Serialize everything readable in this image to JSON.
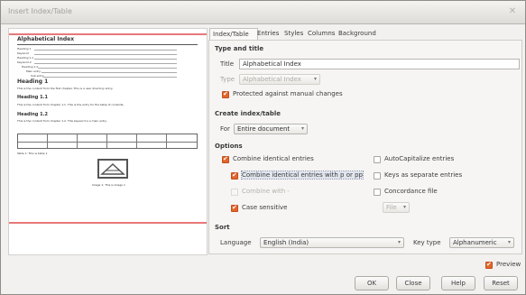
{
  "window": {
    "title": "Insert Index/Table"
  },
  "preview": {
    "heading": "Alphabetical Index",
    "index_entries": [
      "Heading 1",
      "Keyword",
      "Heading 1.1",
      "Keyword 2",
      "Heading 1.2",
      "Main entry",
      "Sub entry"
    ],
    "heading1": "Heading 1",
    "heading1_text": "This is the content from the first chapter. This is a user directory entry.",
    "heading11": "Heading 1.1",
    "heading11_text": "This is the content from chapter 1.1. This is the entry for the table of contents.",
    "heading12": "Heading 1.2",
    "heading12_text": "This is the content from chapter 1.2. This keyword is a main entry.",
    "table_caption": "Table 1: This is table 1",
    "image_caption": "Image 1: This is image 1",
    "show": true
  },
  "tabs": [
    "Index/Table",
    "Entries",
    "Styles",
    "Columns",
    "Background"
  ],
  "type_title": {
    "section": "Type and title",
    "title_label": "Title",
    "title_value": "Alphabetical Index",
    "type_label": "Type",
    "type_value": "Alphabetical Index",
    "protected_label": "Protected against manual changes",
    "protected_checked": true
  },
  "create": {
    "section": "Create index/table",
    "for_label": "For",
    "for_value": "Entire document"
  },
  "options": {
    "section": "Options",
    "combine_identical": "Combine identical entries",
    "combine_pp": "Combine identical entries with p or pp",
    "combine_with": "Combine with -",
    "case_sensitive": "Case sensitive",
    "autocapitalize": "AutoCapitalize entries",
    "keys_separate": "Keys as separate entries",
    "concordance": "Concordance file",
    "file_button": "File",
    "states": {
      "combine_identical": true,
      "combine_pp": true,
      "combine_with": false,
      "case_sensitive": true,
      "autocapitalize": false,
      "keys_separate": false,
      "concordance": false
    }
  },
  "sort": {
    "section": "Sort",
    "language_label": "Language",
    "language_value": "English (India)",
    "keytype_label": "Key type",
    "keytype_value": "Alphanumeric"
  },
  "preview_toggle": {
    "label": "Preview",
    "checked": true
  },
  "buttons": {
    "ok": "OK",
    "close": "Close",
    "help": "Help",
    "reset": "Reset"
  },
  "colors": {
    "accent": "#e2652b",
    "preview_rule": "#e7787a"
  }
}
